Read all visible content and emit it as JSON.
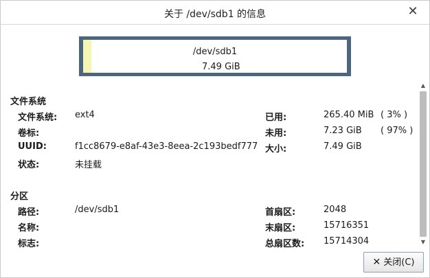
{
  "window": {
    "title": "关于 /dev/sdb1 的信息",
    "close_glyph": "✕"
  },
  "partition_bar": {
    "name": "/dev/sdb1",
    "size": "7.49 GiB",
    "used_fraction": 0.03,
    "colors": {
      "border": "#4c6680",
      "used": "#f6f6b4",
      "free": "#ffffff"
    }
  },
  "filesystem_section": {
    "heading": "文件系统",
    "fs_label": "文件系统:",
    "fs_value": "ext4",
    "volume_label": "卷标:",
    "volume_value": "",
    "uuid_label": "UUID:",
    "uuid_value": "f1cc8679-e8af-43e3-8eea-2c193bedf777",
    "status_label": "状态:",
    "status_value": "未挂载",
    "used_label": "已用:",
    "used_value": "265.40 MiB",
    "used_percent": "( 3% )",
    "unused_label": "未用:",
    "unused_value": "7.23 GiB",
    "unused_percent": "( 97% )",
    "size_label": "大小:",
    "size_value": "7.49 GiB"
  },
  "partition_section": {
    "heading": "分区",
    "path_label": "路径:",
    "path_value": "/dev/sdb1",
    "name_label": "名称:",
    "name_value": "",
    "flags_label": "标志:",
    "flags_value": "",
    "first_sector_label": "首扇区:",
    "first_sector_value": "2048",
    "last_sector_label": "末扇区:",
    "last_sector_value": "15716351",
    "total_sectors_label": "总扇区数:",
    "total_sectors_value": "15714304"
  },
  "buttons": {
    "close_label": "关闭(C)",
    "close_icon": "✕"
  }
}
